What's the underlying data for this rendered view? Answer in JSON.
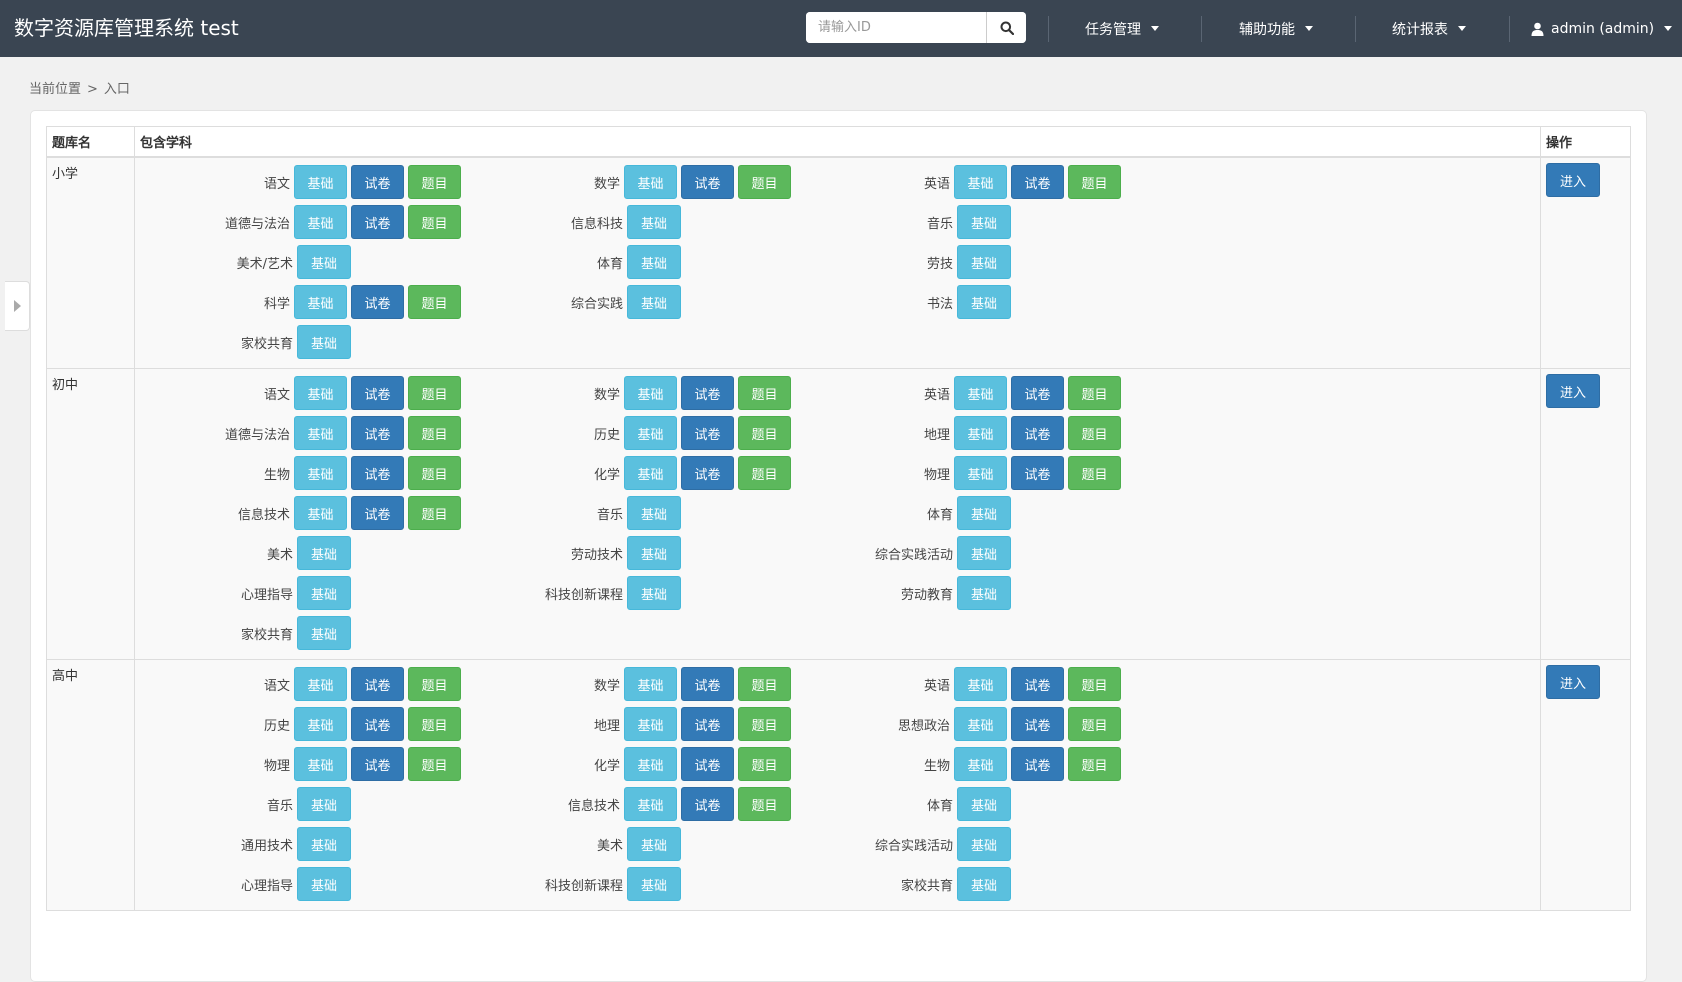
{
  "navbar": {
    "brand": "数字资源库管理系统 test",
    "search_placeholder": "请输入ID",
    "menus": [
      "任务管理",
      "辅助功能",
      "统计报表"
    ],
    "user": "admin (admin)"
  },
  "breadcrumb": {
    "prefix": "当前位置",
    "separator": ">",
    "current": "入口"
  },
  "table": {
    "headers": [
      "题库名",
      "包含学科",
      "操作"
    ],
    "action_label": "进入",
    "button_labels": {
      "basic": "基础",
      "paper": "试卷",
      "question": "题目"
    },
    "rows": [
      {
        "name": "小学",
        "subjects": [
          {
            "name": "语文",
            "buttons": [
              "basic",
              "paper",
              "question"
            ]
          },
          {
            "name": "数学",
            "buttons": [
              "basic",
              "paper",
              "question"
            ]
          },
          {
            "name": "英语",
            "buttons": [
              "basic",
              "paper",
              "question"
            ]
          },
          {
            "name": "道德与法治",
            "buttons": [
              "basic",
              "paper",
              "question"
            ]
          },
          {
            "name": "信息科技",
            "buttons": [
              "basic"
            ]
          },
          {
            "name": "音乐",
            "buttons": [
              "basic"
            ]
          },
          {
            "name": "美术/艺术",
            "buttons": [
              "basic"
            ]
          },
          {
            "name": "体育",
            "buttons": [
              "basic"
            ]
          },
          {
            "name": "劳技",
            "buttons": [
              "basic"
            ]
          },
          {
            "name": "科学",
            "buttons": [
              "basic",
              "paper",
              "question"
            ]
          },
          {
            "name": "综合实践",
            "buttons": [
              "basic"
            ]
          },
          {
            "name": "书法",
            "buttons": [
              "basic"
            ]
          },
          {
            "name": "家校共育",
            "buttons": [
              "basic"
            ]
          }
        ]
      },
      {
        "name": "初中",
        "subjects": [
          {
            "name": "语文",
            "buttons": [
              "basic",
              "paper",
              "question"
            ]
          },
          {
            "name": "数学",
            "buttons": [
              "basic",
              "paper",
              "question"
            ]
          },
          {
            "name": "英语",
            "buttons": [
              "basic",
              "paper",
              "question"
            ]
          },
          {
            "name": "道德与法治",
            "buttons": [
              "basic",
              "paper",
              "question"
            ]
          },
          {
            "name": "历史",
            "buttons": [
              "basic",
              "paper",
              "question"
            ]
          },
          {
            "name": "地理",
            "buttons": [
              "basic",
              "paper",
              "question"
            ]
          },
          {
            "name": "生物",
            "buttons": [
              "basic",
              "paper",
              "question"
            ]
          },
          {
            "name": "化学",
            "buttons": [
              "basic",
              "paper",
              "question"
            ]
          },
          {
            "name": "物理",
            "buttons": [
              "basic",
              "paper",
              "question"
            ]
          },
          {
            "name": "信息技术",
            "buttons": [
              "basic",
              "paper",
              "question"
            ]
          },
          {
            "name": "音乐",
            "buttons": [
              "basic"
            ]
          },
          {
            "name": "体育",
            "buttons": [
              "basic"
            ]
          },
          {
            "name": "美术",
            "buttons": [
              "basic"
            ]
          },
          {
            "name": "劳动技术",
            "buttons": [
              "basic"
            ]
          },
          {
            "name": "综合实践活动",
            "buttons": [
              "basic"
            ]
          },
          {
            "name": "心理指导",
            "buttons": [
              "basic"
            ]
          },
          {
            "name": "科技创新课程",
            "buttons": [
              "basic"
            ]
          },
          {
            "name": "劳动教育",
            "buttons": [
              "basic"
            ]
          },
          {
            "name": "家校共育",
            "buttons": [
              "basic"
            ]
          }
        ]
      },
      {
        "name": "高中",
        "subjects": [
          {
            "name": "语文",
            "buttons": [
              "basic",
              "paper",
              "question"
            ]
          },
          {
            "name": "数学",
            "buttons": [
              "basic",
              "paper",
              "question"
            ]
          },
          {
            "name": "英语",
            "buttons": [
              "basic",
              "paper",
              "question"
            ]
          },
          {
            "name": "历史",
            "buttons": [
              "basic",
              "paper",
              "question"
            ]
          },
          {
            "name": "地理",
            "buttons": [
              "basic",
              "paper",
              "question"
            ]
          },
          {
            "name": "思想政治",
            "buttons": [
              "basic",
              "paper",
              "question"
            ]
          },
          {
            "name": "物理",
            "buttons": [
              "basic",
              "paper",
              "question"
            ]
          },
          {
            "name": "化学",
            "buttons": [
              "basic",
              "paper",
              "question"
            ]
          },
          {
            "name": "生物",
            "buttons": [
              "basic",
              "paper",
              "question"
            ]
          },
          {
            "name": "音乐",
            "buttons": [
              "basic"
            ]
          },
          {
            "name": "信息技术",
            "buttons": [
              "basic",
              "paper",
              "question"
            ]
          },
          {
            "name": "体育",
            "buttons": [
              "basic"
            ]
          },
          {
            "name": "通用技术",
            "buttons": [
              "basic"
            ]
          },
          {
            "name": "美术",
            "buttons": [
              "basic"
            ]
          },
          {
            "name": "综合实践活动",
            "buttons": [
              "basic"
            ]
          },
          {
            "name": "心理指导",
            "buttons": [
              "basic"
            ]
          },
          {
            "name": "科技创新课程",
            "buttons": [
              "basic"
            ]
          },
          {
            "name": "家校共育",
            "buttons": [
              "basic"
            ]
          }
        ]
      }
    ]
  },
  "colors": {
    "navbar_bg": "#3a4552",
    "basic_btn": "#5bc0de",
    "paper_btn": "#337ab7",
    "question_btn": "#5cb85c",
    "enter_btn": "#337ab7"
  },
  "icons": {
    "search": "search-icon",
    "caret": "caret-down-icon",
    "user": "user-icon",
    "sidebar_toggle": "triangle-right-icon"
  }
}
